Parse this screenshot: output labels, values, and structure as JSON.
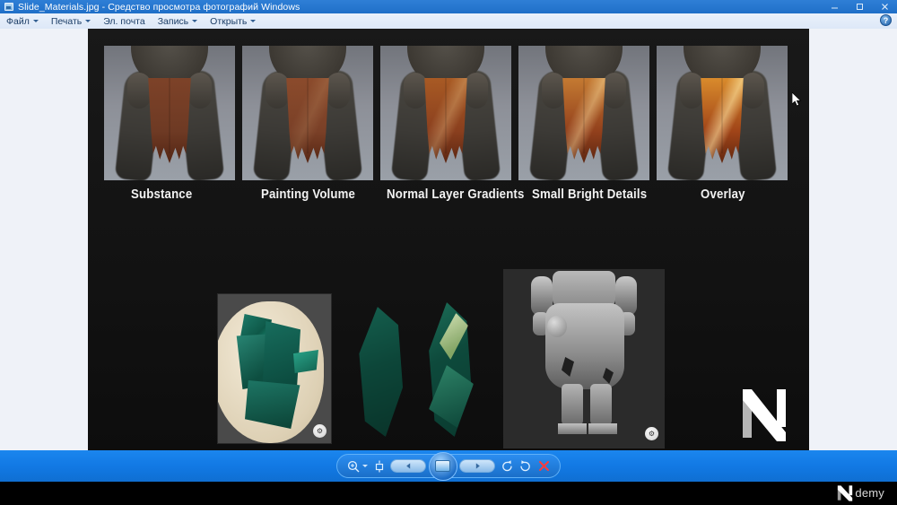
{
  "window": {
    "title": "Slide_Materials.jpg - Средство просмотра фотографий Windows",
    "title_icon": "photo-viewer-icon",
    "controls": {
      "minimize": "minimize-icon",
      "maximize": "maximize-icon",
      "close": "close-icon"
    }
  },
  "menubar": {
    "items": [
      {
        "label": "Файл",
        "has_caret": true
      },
      {
        "label": "Печать",
        "has_caret": true
      },
      {
        "label": "Эл. почта",
        "has_caret": false
      },
      {
        "label": "Запись",
        "has_caret": true
      },
      {
        "label": "Открыть",
        "has_caret": true
      }
    ],
    "help_label": "?"
  },
  "slide": {
    "background_color": "#151515",
    "renders": [
      {
        "label": "Substance",
        "cloth_base": "#6e3a24",
        "cloth_top": "#7d4228",
        "highlight": 0.0
      },
      {
        "label": "Painting Volume",
        "cloth_base": "#7a4027",
        "cloth_top": "#8b4b2c",
        "highlight": 0.12
      },
      {
        "label": "Normal Layer Gradients",
        "cloth_base": "#8a3f1e",
        "cloth_top": "#a85a24",
        "highlight": 0.28
      },
      {
        "label": "Small Bright Details",
        "cloth_base": "#92401c",
        "cloth_top": "#c47a32",
        "highlight": 0.45
      },
      {
        "label": "Overlay",
        "cloth_base": "#a04418",
        "cloth_top": "#d98b2c",
        "highlight": 0.62
      }
    ],
    "reference_photo": {
      "name": "emerald-crystal-photo",
      "badge": "watermark-badge"
    },
    "paint_studies": [
      {
        "name": "crystal-study-dark",
        "color": "#0f4f44"
      },
      {
        "name": "crystal-study-light",
        "color": "#14614f"
      }
    ],
    "sculpt": {
      "name": "character-sculpt-render",
      "badge": "watermark-badge"
    },
    "logo": "n-logo"
  },
  "toolbar": {
    "zoom": "magnifier-icon",
    "fit": "fit-to-window-icon",
    "previous": "previous-icon",
    "play": "slideshow-icon",
    "next": "next-icon",
    "rotate_left": "rotate-counterclockwise-icon",
    "rotate_right": "rotate-clockwise-icon",
    "delete": "delete-icon",
    "accent_color": "#1279e4"
  },
  "watermark": {
    "logo": "n-logo",
    "text": "demy"
  }
}
